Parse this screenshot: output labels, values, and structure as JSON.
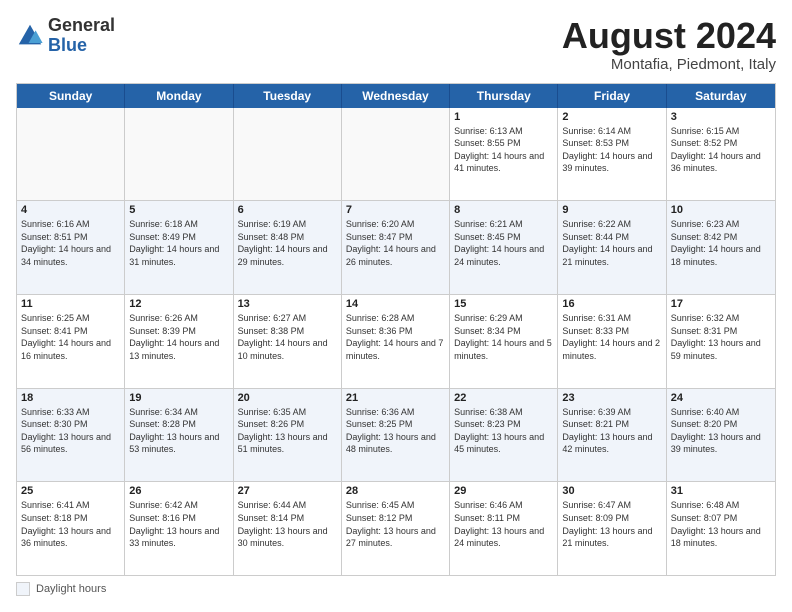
{
  "logo": {
    "general": "General",
    "blue": "Blue"
  },
  "title": "August 2024",
  "subtitle": "Montafia, Piedmont, Italy",
  "days_of_week": [
    "Sunday",
    "Monday",
    "Tuesday",
    "Wednesday",
    "Thursday",
    "Friday",
    "Saturday"
  ],
  "footer_label": "Daylight hours",
  "weeks": [
    [
      {
        "day": "",
        "info": ""
      },
      {
        "day": "",
        "info": ""
      },
      {
        "day": "",
        "info": ""
      },
      {
        "day": "",
        "info": ""
      },
      {
        "day": "1",
        "info": "Sunrise: 6:13 AM\nSunset: 8:55 PM\nDaylight: 14 hours and 41 minutes."
      },
      {
        "day": "2",
        "info": "Sunrise: 6:14 AM\nSunset: 8:53 PM\nDaylight: 14 hours and 39 minutes."
      },
      {
        "day": "3",
        "info": "Sunrise: 6:15 AM\nSunset: 8:52 PM\nDaylight: 14 hours and 36 minutes."
      }
    ],
    [
      {
        "day": "4",
        "info": "Sunrise: 6:16 AM\nSunset: 8:51 PM\nDaylight: 14 hours and 34 minutes."
      },
      {
        "day": "5",
        "info": "Sunrise: 6:18 AM\nSunset: 8:49 PM\nDaylight: 14 hours and 31 minutes."
      },
      {
        "day": "6",
        "info": "Sunrise: 6:19 AM\nSunset: 8:48 PM\nDaylight: 14 hours and 29 minutes."
      },
      {
        "day": "7",
        "info": "Sunrise: 6:20 AM\nSunset: 8:47 PM\nDaylight: 14 hours and 26 minutes."
      },
      {
        "day": "8",
        "info": "Sunrise: 6:21 AM\nSunset: 8:45 PM\nDaylight: 14 hours and 24 minutes."
      },
      {
        "day": "9",
        "info": "Sunrise: 6:22 AM\nSunset: 8:44 PM\nDaylight: 14 hours and 21 minutes."
      },
      {
        "day": "10",
        "info": "Sunrise: 6:23 AM\nSunset: 8:42 PM\nDaylight: 14 hours and 18 minutes."
      }
    ],
    [
      {
        "day": "11",
        "info": "Sunrise: 6:25 AM\nSunset: 8:41 PM\nDaylight: 14 hours and 16 minutes."
      },
      {
        "day": "12",
        "info": "Sunrise: 6:26 AM\nSunset: 8:39 PM\nDaylight: 14 hours and 13 minutes."
      },
      {
        "day": "13",
        "info": "Sunrise: 6:27 AM\nSunset: 8:38 PM\nDaylight: 14 hours and 10 minutes."
      },
      {
        "day": "14",
        "info": "Sunrise: 6:28 AM\nSunset: 8:36 PM\nDaylight: 14 hours and 7 minutes."
      },
      {
        "day": "15",
        "info": "Sunrise: 6:29 AM\nSunset: 8:34 PM\nDaylight: 14 hours and 5 minutes."
      },
      {
        "day": "16",
        "info": "Sunrise: 6:31 AM\nSunset: 8:33 PM\nDaylight: 14 hours and 2 minutes."
      },
      {
        "day": "17",
        "info": "Sunrise: 6:32 AM\nSunset: 8:31 PM\nDaylight: 13 hours and 59 minutes."
      }
    ],
    [
      {
        "day": "18",
        "info": "Sunrise: 6:33 AM\nSunset: 8:30 PM\nDaylight: 13 hours and 56 minutes."
      },
      {
        "day": "19",
        "info": "Sunrise: 6:34 AM\nSunset: 8:28 PM\nDaylight: 13 hours and 53 minutes."
      },
      {
        "day": "20",
        "info": "Sunrise: 6:35 AM\nSunset: 8:26 PM\nDaylight: 13 hours and 51 minutes."
      },
      {
        "day": "21",
        "info": "Sunrise: 6:36 AM\nSunset: 8:25 PM\nDaylight: 13 hours and 48 minutes."
      },
      {
        "day": "22",
        "info": "Sunrise: 6:38 AM\nSunset: 8:23 PM\nDaylight: 13 hours and 45 minutes."
      },
      {
        "day": "23",
        "info": "Sunrise: 6:39 AM\nSunset: 8:21 PM\nDaylight: 13 hours and 42 minutes."
      },
      {
        "day": "24",
        "info": "Sunrise: 6:40 AM\nSunset: 8:20 PM\nDaylight: 13 hours and 39 minutes."
      }
    ],
    [
      {
        "day": "25",
        "info": "Sunrise: 6:41 AM\nSunset: 8:18 PM\nDaylight: 13 hours and 36 minutes."
      },
      {
        "day": "26",
        "info": "Sunrise: 6:42 AM\nSunset: 8:16 PM\nDaylight: 13 hours and 33 minutes."
      },
      {
        "day": "27",
        "info": "Sunrise: 6:44 AM\nSunset: 8:14 PM\nDaylight: 13 hours and 30 minutes."
      },
      {
        "day": "28",
        "info": "Sunrise: 6:45 AM\nSunset: 8:12 PM\nDaylight: 13 hours and 27 minutes."
      },
      {
        "day": "29",
        "info": "Sunrise: 6:46 AM\nSunset: 8:11 PM\nDaylight: 13 hours and 24 minutes."
      },
      {
        "day": "30",
        "info": "Sunrise: 6:47 AM\nSunset: 8:09 PM\nDaylight: 13 hours and 21 minutes."
      },
      {
        "day": "31",
        "info": "Sunrise: 6:48 AM\nSunset: 8:07 PM\nDaylight: 13 hours and 18 minutes."
      }
    ]
  ]
}
